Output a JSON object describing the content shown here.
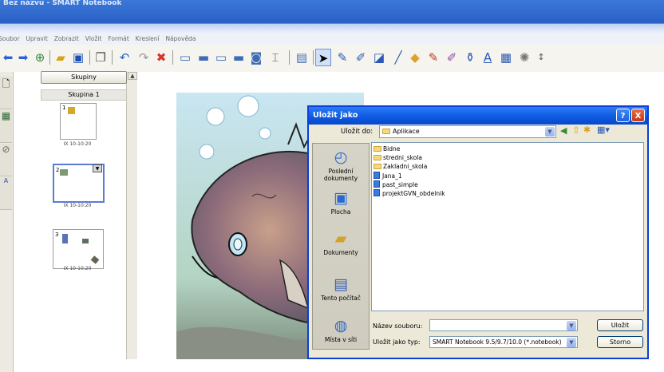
{
  "window": {
    "title": "Bez názvu - SMART Notebook"
  },
  "menu": [
    "Soubor",
    "Upravit",
    "Zobrazit",
    "Vložit",
    "Formát",
    "Kreslení",
    "Nápověda"
  ],
  "sorter": {
    "groups_button": "Skupiny",
    "group_name": "Skupina 1",
    "pages": [
      {
        "number": "1",
        "timestamp": "IX 10-10:20"
      },
      {
        "number": "2",
        "timestamp": "IX 10-10:20"
      },
      {
        "number": "3",
        "timestamp": "IX 10-10:20"
      }
    ]
  },
  "dialog": {
    "title": "Uložit jako",
    "look_in_label": "Uložit do:",
    "look_in_value": "Aplikace",
    "places": [
      {
        "label": "Poslední dokumenty",
        "icon": "recent-documents-icon"
      },
      {
        "label": "Plocha",
        "icon": "desktop-icon"
      },
      {
        "label": "Dokumenty",
        "icon": "my-documents-icon"
      },
      {
        "label": "Tento počítač",
        "icon": "my-computer-icon"
      },
      {
        "label": "Místa v síti",
        "icon": "network-places-icon"
      }
    ],
    "files": [
      {
        "name": "Bidne",
        "type": "folder"
      },
      {
        "name": "stredni_skola",
        "type": "folder"
      },
      {
        "name": "Zakladni_skola",
        "type": "folder"
      },
      {
        "name": "Jana_1",
        "type": "notebook"
      },
      {
        "name": "past_simple",
        "type": "notebook"
      },
      {
        "name": "projektGVN_obdelnik",
        "type": "notebook"
      }
    ],
    "filename_label": "Název souboru:",
    "filename_value": "",
    "filetype_label": "Uložit jako typ:",
    "filetype_value": "SMART Notebook 9.5/9.7/10.0 (*.notebook)",
    "save_button": "Uložit",
    "cancel_button": "Storno",
    "help_button": "?",
    "close_button": "X"
  }
}
